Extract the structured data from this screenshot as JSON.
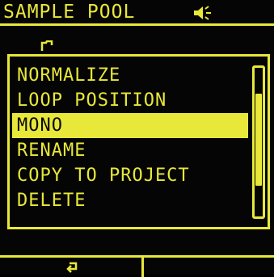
{
  "header": {
    "title": "SAMPLE POOL",
    "speaker_icon": "speaker-icon"
  },
  "folder": {
    "icon": "folder-icon"
  },
  "menu": {
    "items": [
      {
        "label": "NORMALIZE",
        "selected": false
      },
      {
        "label": "LOOP POSITION",
        "selected": false
      },
      {
        "label": "MONO",
        "selected": true
      },
      {
        "label": "RENAME",
        "selected": false
      },
      {
        "label": "COPY TO PROJECT",
        "selected": false
      },
      {
        "label": "DELETE",
        "selected": false
      }
    ],
    "scroll_position": 0.45
  },
  "footer": {
    "left_icon": "return-icon"
  },
  "colors": {
    "foreground": "#e8e83a",
    "background": "#050505"
  }
}
